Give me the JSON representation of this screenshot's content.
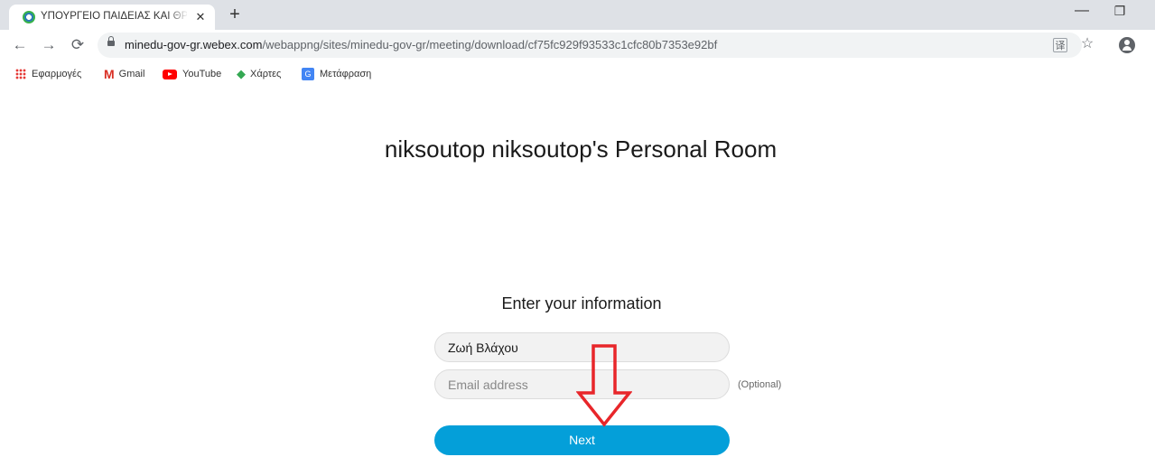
{
  "browser": {
    "tab_title": "ΥΠΟΥΡΓΕΙΟ ΠΑΙΔΕΙΑΣ ΚΑΙ ΘΡΗΣΚ",
    "tab_close": "✕",
    "new_tab": "+",
    "window_min": "—",
    "window_restore": "❐",
    "url_host": "minedu-gov-gr.webex.com",
    "url_path": "/webappng/sites/minedu-gov-gr/meeting/download/cf75fc929f93533c1cfc80b7353e92bf",
    "icons": {
      "back": "back-arrow-icon",
      "forward": "forward-arrow-icon",
      "reload": "reload-icon",
      "lock": "lock-icon",
      "translate": "translate-icon",
      "star": "star-icon",
      "account": "account-icon"
    }
  },
  "bookmarks": [
    {
      "label": "Εφαρμογές",
      "icon": "apps-grid-icon"
    },
    {
      "label": "Gmail",
      "icon": "gmail-icon"
    },
    {
      "label": "YouTube",
      "icon": "youtube-icon"
    },
    {
      "label": "Χάρτες",
      "icon": "maps-icon"
    },
    {
      "label": "Μετάφραση",
      "icon": "translate-bookmark-icon"
    }
  ],
  "page": {
    "room_title": "niksoutop niksoutop's Personal Room",
    "form_heading": "Enter your information",
    "name_value": "Ζωή Βλάχου",
    "email_placeholder": "Email address",
    "email_value": "",
    "optional_label": "(Optional)",
    "next_label": "Next",
    "accent_color": "#049fd9",
    "annotation_arrow_color": "#e8262a"
  }
}
